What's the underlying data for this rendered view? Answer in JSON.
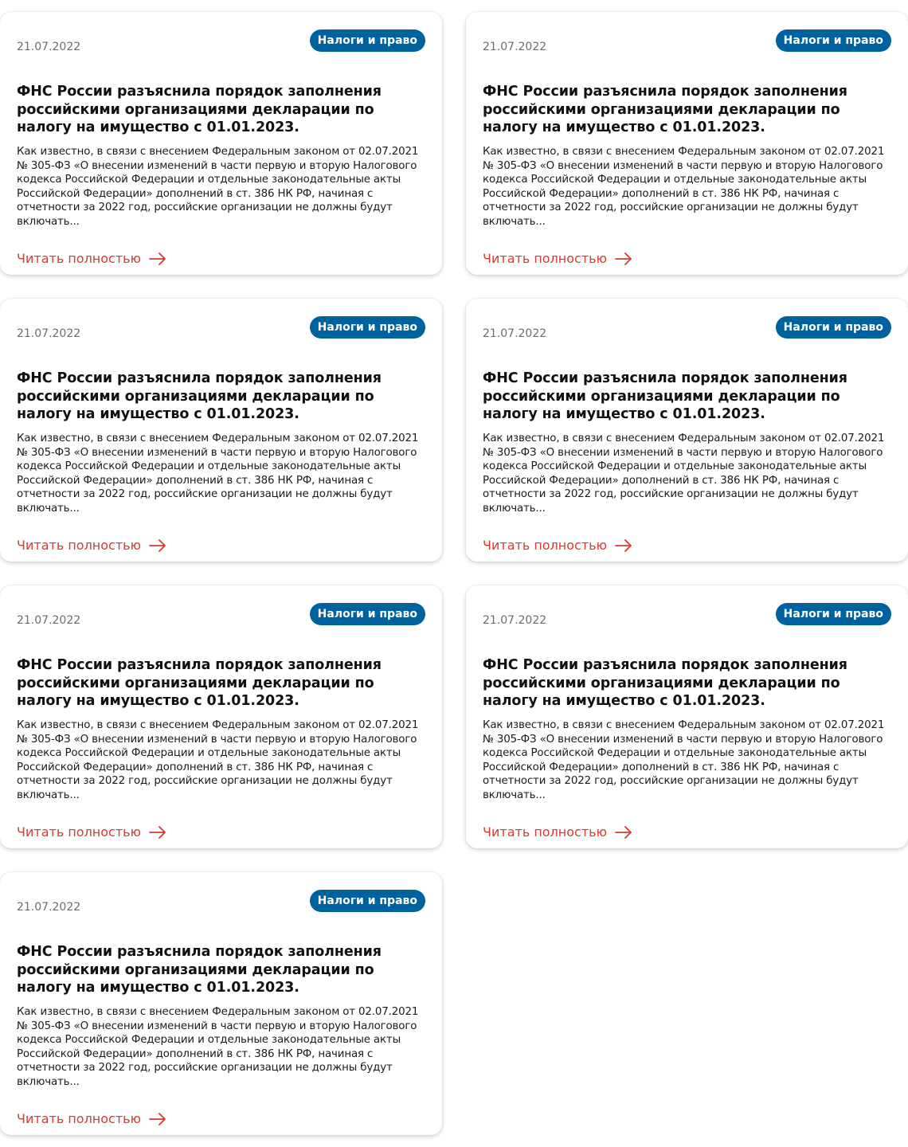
{
  "accent_color": "#d83a31",
  "tag_color": "#00619f",
  "news": [
    {
      "date": "21.07.2022",
      "tag": "Налоги и право",
      "title": "ФНС России разъяснила порядок заполнения российскими организациями декларации по налогу на имущество с 01.01.2023.",
      "excerpt": "Как известно, в связи с внесением Федеральным законом от 02.07.2021 № 305-ФЗ «О внесении изменений в части первую и вторую Налогового кодекса Российской Федерации и отдельные законодательные акты Российской Федерации» дополнений в ст. 386 НК РФ, начиная с отчетности за 2022 год, российские организации не должны будут включать...",
      "link_label": "Читать полностью",
      "link_icon": "arrow-right-icon"
    },
    {
      "date": "21.07.2022",
      "tag": "Налоги и право",
      "title": "ФНС России разъяснила порядок заполнения российскими организациями декларации по налогу на имущество с 01.01.2023.",
      "excerpt": "Как известно, в связи с внесением Федеральным законом от 02.07.2021 № 305-ФЗ «О внесении изменений в части первую и вторую Налогового кодекса Российской Федерации и отдельные законодательные акты Российской Федерации» дополнений в ст. 386 НК РФ, начиная с отчетности за 2022 год, российские организации не должны будут включать...",
      "link_label": "Читать полностью",
      "link_icon": "arrow-right-icon"
    },
    {
      "date": "21.07.2022",
      "tag": "Налоги и право",
      "title": "ФНС России разъяснила порядок заполнения российскими организациями декларации по налогу на имущество с 01.01.2023.",
      "excerpt": "Как известно, в связи с внесением Федеральным законом от 02.07.2021 № 305-ФЗ «О внесении изменений в части первую и вторую Налогового кодекса Российской Федерации и отдельные законодательные акты Российской Федерации» дополнений в ст. 386 НК РФ, начиная с отчетности за 2022 год, российские организации не должны будут включать...",
      "link_label": "Читать полностью",
      "link_icon": "arrow-right-icon"
    },
    {
      "date": "21.07.2022",
      "tag": "Налоги и право",
      "title": "ФНС России разъяснила порядок заполнения российскими организациями декларации по налогу на имущество с 01.01.2023.",
      "excerpt": "Как известно, в связи с внесением Федеральным законом от 02.07.2021 № 305-ФЗ «О внесении изменений в части первую и вторую Налогового кодекса Российской Федерации и отдельные законодательные акты Российской Федерации» дополнений в ст. 386 НК РФ, начиная с отчетности за 2022 год, российские организации не должны будут включать...",
      "link_label": "Читать полностью",
      "link_icon": "arrow-right-icon"
    },
    {
      "date": "21.07.2022",
      "tag": "Налоги и право",
      "title": "ФНС России разъяснила порядок заполнения российскими организациями декларации по налогу на имущество с 01.01.2023.",
      "excerpt": "Как известно, в связи с внесением Федеральным законом от 02.07.2021 № 305-ФЗ «О внесении изменений в части первую и вторую Налогового кодекса Российской Федерации и отдельные законодательные акты Российской Федерации» дополнений в ст. 386 НК РФ, начиная с отчетности за 2022 год, российские организации не должны будут включать...",
      "link_label": "Читать полностью",
      "link_icon": "arrow-right-icon"
    },
    {
      "date": "21.07.2022",
      "tag": "Налоги и право",
      "title": "ФНС России разъяснила порядок заполнения российскими организациями декларации по налогу на имущество с 01.01.2023.",
      "excerpt": "Как известно, в связи с внесением Федеральным законом от 02.07.2021 № 305-ФЗ «О внесении изменений в части первую и вторую Налогового кодекса Российской Федерации и отдельные законодательные акты Российской Федерации» дополнений в ст. 386 НК РФ, начиная с отчетности за 2022 год, российские организации не должны будут включать...",
      "link_label": "Читать полностью",
      "link_icon": "arrow-right-icon"
    },
    {
      "date": "21.07.2022",
      "tag": "Налоги и право",
      "title": "ФНС России разъяснила порядок заполнения российскими организациями декларации по налогу на имущество с 01.01.2023.",
      "excerpt": "Как известно, в связи с внесением Федеральным законом от 02.07.2021 № 305-ФЗ «О внесении изменений в части первую и вторую Налогового кодекса Российской Федерации и отдельные законодательные акты Российской Федерации» дополнений в ст. 386 НК РФ, начиная с отчетности за 2022 год, российские организации не должны будут включать...",
      "link_label": "Читать полностью",
      "link_icon": "arrow-right-icon"
    }
  ]
}
